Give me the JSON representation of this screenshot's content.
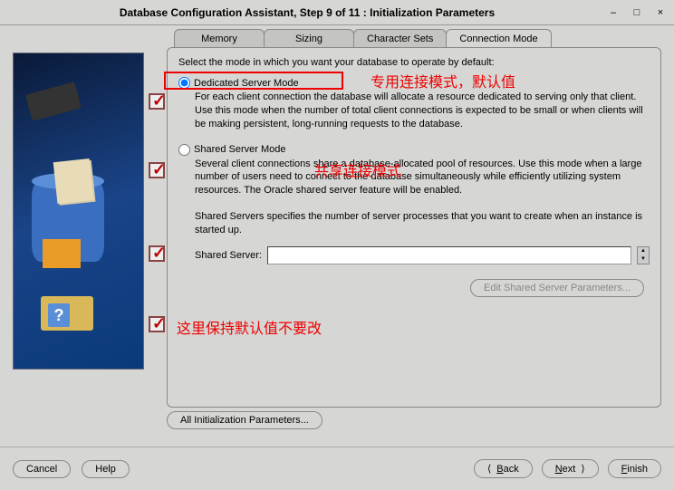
{
  "window": {
    "title": "Database Configuration Assistant, Step 9 of 11 : Initialization Parameters"
  },
  "tabs": {
    "memory": "Memory",
    "sizing": "Sizing",
    "charsets": "Character Sets",
    "connmode": "Connection Mode"
  },
  "panel": {
    "instruction": "Select the mode in which you want your database to operate by default:",
    "dedicated_label": "Dedicated Server Mode",
    "dedicated_desc": "For each client connection the database will allocate a resource dedicated to serving only that client.  Use this mode when the number of total client connections is expected to be small or when clients will be making persistent, long-running requests to the database.",
    "shared_label": "Shared Server Mode",
    "shared_desc": "Several client connections share a database-allocated pool of resources.  Use this mode when a large number of users need to connect to the database simultaneously while efficiently utilizing system resources.  The Oracle shared server feature will be enabled.",
    "shared_note": "Shared Servers specifies the number of server processes that you want to create when an instance is started up.",
    "shared_server_label": "Shared Server:",
    "shared_server_value": "",
    "edit_params_btn": "Edit Shared Server Parameters...",
    "all_params_btn": "All Initialization Parameters..."
  },
  "footer": {
    "cancel": "Cancel",
    "help": "Help",
    "back": "Back",
    "next": "Next",
    "finish": "Finish"
  },
  "annotations": {
    "dedicated_note": "专用连接模式，默认值",
    "shared_note": "共享连接模式",
    "bottom_note": "这里保持默认值不要改"
  }
}
